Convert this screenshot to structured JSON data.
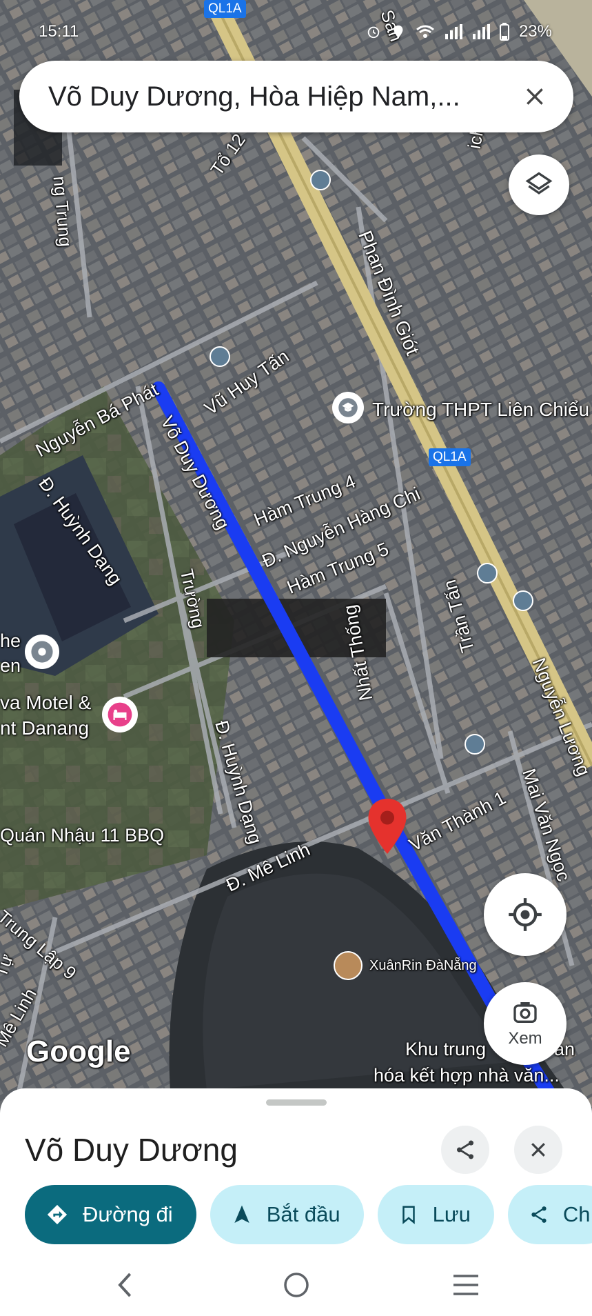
{
  "status_bar": {
    "time": "15:11",
    "battery": "23%"
  },
  "search": {
    "query": "Võ Duy Dương, Hòa Hiệp Nam,..."
  },
  "map": {
    "highway_labels": [
      "QL1A",
      "QL1A"
    ],
    "streets": [
      "Tổ 12",
      "Phan Đình Giót",
      "Vũ Huy Tấn",
      "Nguyễn Bá Phát",
      "Võ Duy Dương",
      "Hàm Trung 4",
      "Đ. Nguyễn Hàng Chi",
      "Hàm Trung 5",
      "Đ. Huỳnh Dạng",
      "Trường",
      "Nhất Thống",
      "Trần Tấn",
      "Nguyễn Lương",
      "Văn Thành 1",
      "Mai Văn Ngọc",
      "Đ. Mê Linh",
      "Đ. Huỳnh Dạng",
      "Trung Lập 9",
      "Mê Linh",
      "Tự",
      "ng Trung",
      "ich Sa",
      "San"
    ],
    "places": {
      "school": "Trường THPT Liên Chiểu",
      "motel_line1": "va Motel &",
      "motel_line2": "nt Danang",
      "poi_left_line1": "he",
      "poi_left_line2": "en",
      "restaurant": "Quán Nhậu 11 BBQ",
      "contributor": "XuânRin ĐàNẵng",
      "area_line1": "Khu trung",
      "area_line1b": "an",
      "area_line2": "hóa kết hợp nhà văn..."
    },
    "logo": "Google"
  },
  "buttons": {
    "xem": "Xem"
  },
  "sheet": {
    "title": "Võ Duy Dương",
    "chips": {
      "directions": "Đường đi",
      "start": "Bắt đầu",
      "save": "Lưu",
      "share": "Ch"
    }
  },
  "colors": {
    "route": "#1a3cf2",
    "primary_chip": "#0b6b7e",
    "secondary_chip": "#c5eff8",
    "pin": "#e5322d"
  }
}
